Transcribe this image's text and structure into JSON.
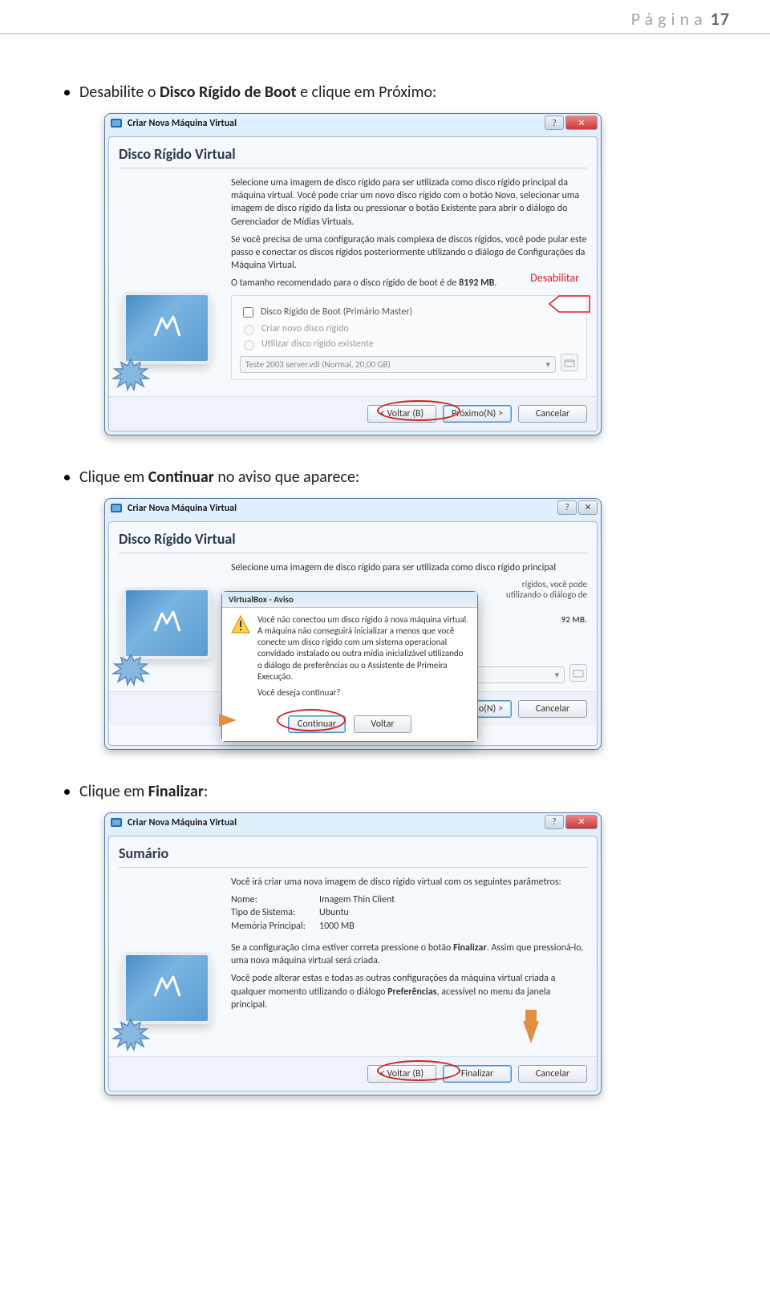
{
  "page_header": {
    "label": "Página",
    "number": "17"
  },
  "step1": {
    "pre": "Desabilite o ",
    "bold": "Disco Rígido de Boot",
    "post": " e clique em Próximo:"
  },
  "step2": {
    "pre": "Clique em ",
    "bold": "Continuar",
    "post": " no aviso que aparece:"
  },
  "step3": {
    "pre": "Clique em ",
    "bold": "Finalizar",
    "post": ":"
  },
  "dialog_common": {
    "window_title": "Criar Nova Máquina Virtual",
    "btn_back": "< Voltar (B)",
    "btn_next": "Próximo(N) >",
    "btn_cancel": "Cancelar",
    "btn_finish": "Finalizar"
  },
  "dlg1": {
    "heading": "Disco Rígido Virtual",
    "para1": "Selecione uma imagem de disco rígido para ser utilizada como disco rígido principal da máquina virtual. Você pode criar um novo disco rígido com o botão Novo, selecionar uma imagem de disco rígido da lista ou pressionar o botão Existente para abrir o diálogo do Gerenciador de Mídias Virtuais.",
    "para2": "Se você precisa de uma configuração mais complexa de discos rígidos, você pode pular este passo e conectar os discos rígidos posteriormente utilizando o diálogo de Configurações da Máquina Virtual.",
    "para3a": "O tamanho recomendado para o disco rígido de boot é de ",
    "para3b": "8192 MB",
    "para3c": ".",
    "opt_boot": "Disco Rígido de Boot (Primário Master)",
    "opt_new": "Criar novo disco rígido",
    "opt_existing": "Utilizar disco rígido existente",
    "combo": "Teste 2003 server.vdi (Normal, 20,00 GB)",
    "callout": "Desabilitar"
  },
  "dlg2": {
    "heading": "Disco Rígido Virtual",
    "para1": "Selecione uma imagem de disco rígido para ser utilizada como disco rígido principal",
    "alert_title": "VirtualBox - Aviso",
    "alert_msg": "Você não conectou um disco rígido à nova máquina virtual. A máquina não conseguirá inicializar a menos que você conecte um disco rígido com um sistema operacional convidado instalado ou outra mídia inicializável utilizando o diálogo de preferências ou o Assistente de Primeira Execução.",
    "alert_q": "Você deseja continuar?",
    "btn_continue": "Continuar",
    "btn_back2": "Voltar",
    "rhs1": "rígidos, você pode",
    "rhs2": "utilizando o diálogo de",
    "rhs3": "92 MB."
  },
  "dlg3": {
    "heading": "Sumário",
    "para1": "Você irá criar uma nova imagem de disco rígido virtual com os seguintes parâmetros:",
    "name_lbl": "Nome:",
    "name_val": "Imagem Thin Client",
    "type_lbl": "Tipo de Sistema:",
    "type_val": "Ubuntu",
    "mem_lbl": "Memória Principal:",
    "mem_val": "1000 MB",
    "para2a": "Se a configuração cima estiver correta pressione o botão ",
    "para2b": "Finalizar",
    "para2c": ". Assim que pressioná-lo, uma nova máquina virtual será criada.",
    "para3a": "Você pode alterar estas e todas as outras configurações da máquina virtual criada a qualquer momento utilizando o diálogo ",
    "para3b": "Preferências",
    "para3c": ", acessível no menu da janela principal."
  }
}
